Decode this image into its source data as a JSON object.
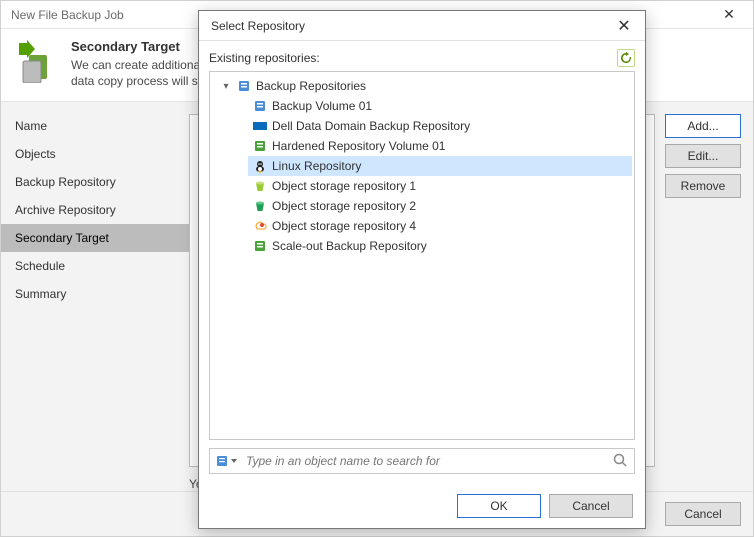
{
  "wizard": {
    "window_title": "New File Backup Job",
    "header_title": "Secondary Target",
    "header_desc_1": "We can create additional copies of the backups produced by this job, and manage their retention policy. The",
    "header_desc_2": "data copy process will start automatically after each primary backup or backup copy run.",
    "nav": [
      "Name",
      "Objects",
      "Backup Repository",
      "Archive Repository",
      "Secondary Target",
      "Schedule",
      "Summary"
    ],
    "nav_active_index": 4,
    "side_buttons": {
      "add": "Add...",
      "edit": "Edit...",
      "remove": "Remove"
    },
    "hint_1": "You can customize retention,",
    "footer": {
      "cancel": "Cancel"
    }
  },
  "modal": {
    "title": "Select Repository",
    "label": "Existing repositories:",
    "root_label": "Backup Repositories",
    "items": [
      {
        "label": "Backup Volume 01",
        "icon": "disk-blue"
      },
      {
        "label": "Dell Data Domain Backup Repository",
        "icon": "dell"
      },
      {
        "label": "Hardened Repository Volume 01",
        "icon": "disk-green"
      },
      {
        "label": "Linux Repository",
        "icon": "linux",
        "selected": true
      },
      {
        "label": "Object storage repository 1",
        "icon": "bucket-lime"
      },
      {
        "label": "Object storage repository 2",
        "icon": "bucket-green"
      },
      {
        "label": "Object storage repository 4",
        "icon": "cloud"
      },
      {
        "label": "Scale-out Backup Repository",
        "icon": "disk-green"
      }
    ],
    "search_placeholder": "Type in an object name to search for",
    "ok": "OK",
    "cancel": "Cancel"
  }
}
